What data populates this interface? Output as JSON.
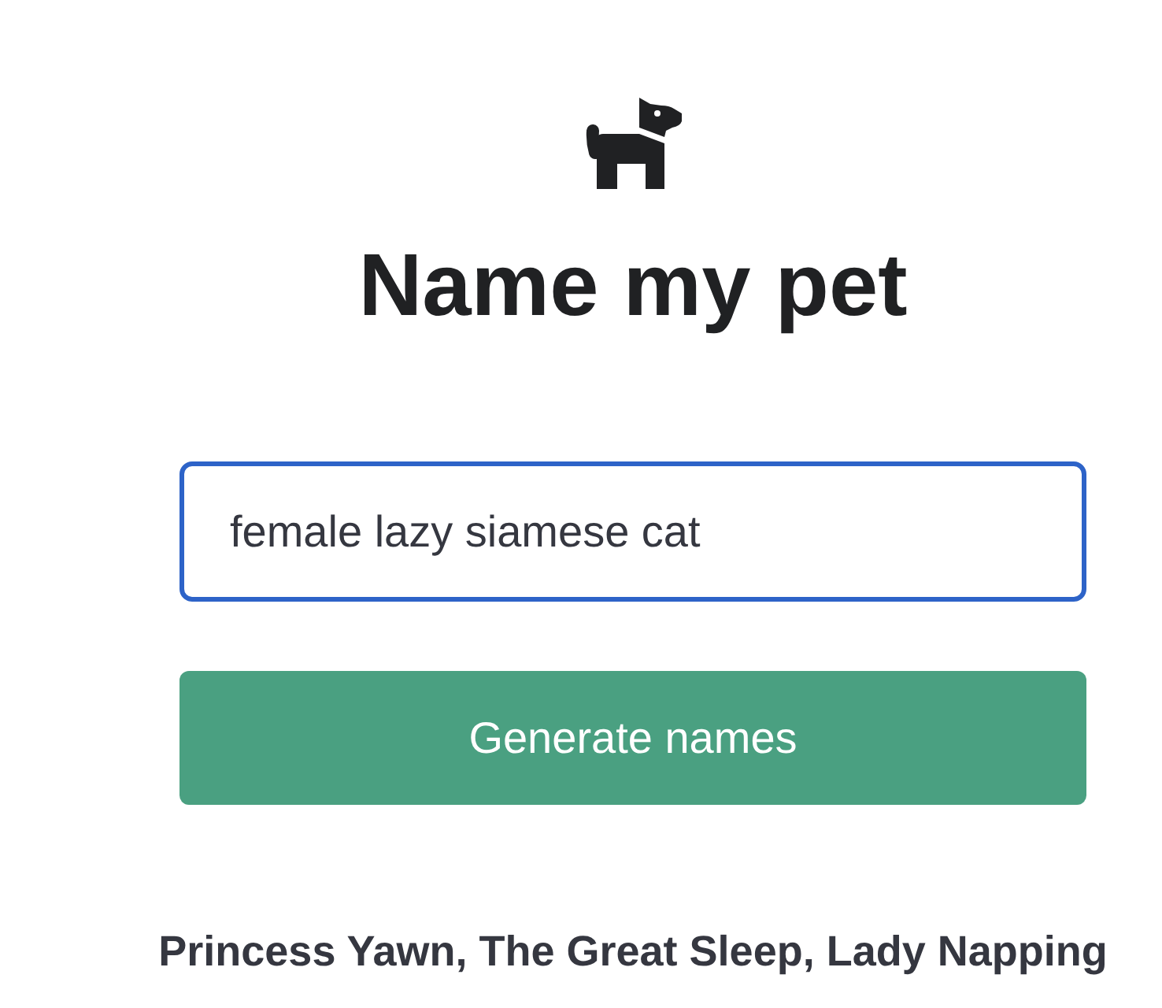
{
  "header": {
    "title": "Name my pet"
  },
  "form": {
    "input": {
      "value": "female lazy siamese cat",
      "focused": true
    },
    "button": {
      "label": "Generate names"
    }
  },
  "result": {
    "text": "Princess Yawn, The Great Sleep, Lady Napping"
  }
}
